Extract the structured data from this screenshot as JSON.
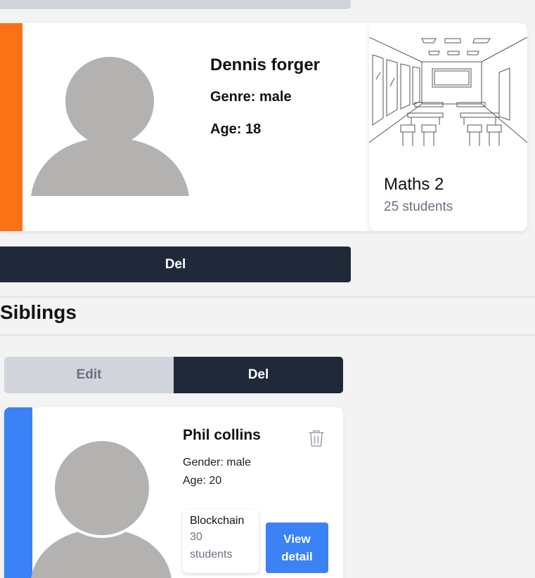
{
  "student": {
    "name": "Dennis forger",
    "genre": "Genre: male",
    "age": "Age: 18",
    "accent_color": "#f97316",
    "class": {
      "name": "Maths 2",
      "students": "25 students"
    }
  },
  "actions": {
    "del_label": "Del"
  },
  "siblings": {
    "title": "Siblings",
    "edit_label": "Edit",
    "del_label": "Del",
    "items": [
      {
        "name": "Phil collins",
        "gender": "Gender: male",
        "age": "Age: 20",
        "accent_color": "#3b82f6",
        "class": {
          "name": "Blockchain",
          "students": "30 students"
        },
        "view_detail_label": "View detail",
        "delete_icon": "trash-icon"
      }
    ]
  }
}
